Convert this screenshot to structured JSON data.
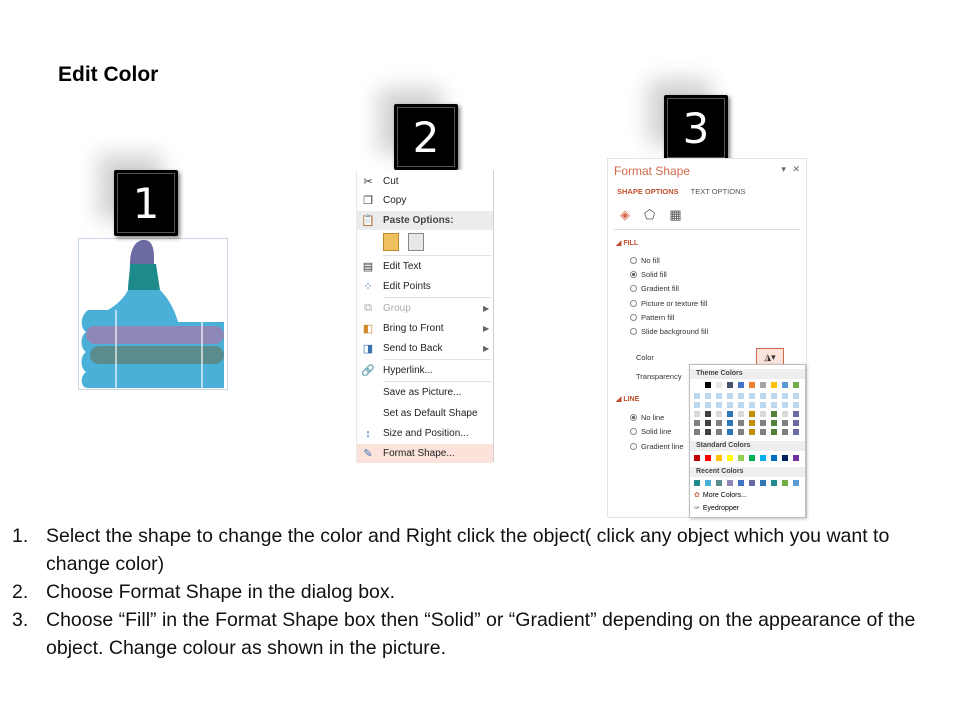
{
  "title": "Edit Color",
  "steps": [
    "1",
    "2",
    "3"
  ],
  "context_menu": {
    "items": [
      {
        "label": "Cut",
        "icon": "scissors-icon"
      },
      {
        "label": "Copy",
        "icon": "copy-icon"
      },
      {
        "label": "Paste Options:",
        "icon": "paste-icon"
      },
      {
        "label": "Edit Text",
        "icon": "edit-text-icon"
      },
      {
        "label": "Edit Points",
        "icon": "edit-points-icon"
      },
      {
        "label": "Group",
        "icon": "group-icon"
      },
      {
        "label": "Bring to Front",
        "icon": "bring-front-icon"
      },
      {
        "label": "Send to Back",
        "icon": "send-back-icon"
      },
      {
        "label": "Hyperlink...",
        "icon": "hyperlink-icon"
      },
      {
        "label": "Save as Picture...",
        "icon": ""
      },
      {
        "label": "Set as Default Shape",
        "icon": ""
      },
      {
        "label": "Size and Position...",
        "icon": "size-position-icon"
      },
      {
        "label": "Format Shape...",
        "icon": "format-shape-icon"
      }
    ]
  },
  "format_shape": {
    "title": "Format Shape",
    "tabs": [
      "SHAPE OPTIONS",
      "TEXT OPTIONS"
    ],
    "fill_header": "FILL",
    "fill_options": [
      "No fill",
      "Solid fill",
      "Gradient fill",
      "Picture or texture fill",
      "Pattern fill",
      "Slide background fill"
    ],
    "selected_fill": "Solid fill",
    "color_label": "Color",
    "transparency_label": "Transparency",
    "line_header": "LINE",
    "line_options": [
      "No line",
      "Solid line",
      "Gradient line"
    ],
    "selected_line": "No line",
    "palette": {
      "theme_colors": "Theme Colors",
      "standard_colors": "Standard Colors",
      "recent_colors": "Recent Colors",
      "more_colors": "More Colors...",
      "eyedropper": "Eyedropper"
    }
  },
  "instructions": [
    {
      "num": "1.",
      "text": "Select the shape to change the color and Right click the object( click any object which you want to change color)"
    },
    {
      "num": "2.",
      "text": "Choose Format Shape in the dialog box."
    },
    {
      "num": "3.",
      "text": "Choose “Fill” in the Format Shape box then “Solid” or “Gradient” depending on the appearance of the object. Change colour as shown in the picture."
    }
  ],
  "colors": {
    "accent": "#c0502d",
    "thumb_purple": "#6b6aa3",
    "thumb_teal": "#1f8a8c",
    "thumb_blue": "#4ab0d8",
    "thumb_lavender": "#8f88b7",
    "thumb_gray_teal": "#5a8c8d"
  }
}
